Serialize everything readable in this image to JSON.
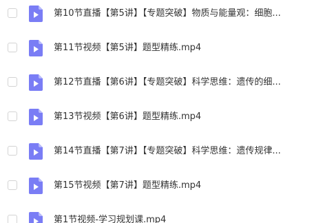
{
  "file_list": {
    "icon": "video-file-icon",
    "icon_color": "#7a7df5",
    "items": [
      {
        "name": "第10节直播【第5讲】【专题突破】物质与能量观：细胞..."
      },
      {
        "name": "第11节视频【第5讲】题型精练.mp4"
      },
      {
        "name": "第12节直播【第6讲】【专题突破】科学思维：遗传的细..."
      },
      {
        "name": "第13节视频【第6讲】题型精练.mp4"
      },
      {
        "name": "第14节直播【第7讲】【专题突破】科学思维：遗传规律..."
      },
      {
        "name": "第15节视频【第7讲】题型精练.mp4"
      },
      {
        "name": "第1节视频-学习规划课.mp4"
      }
    ]
  }
}
